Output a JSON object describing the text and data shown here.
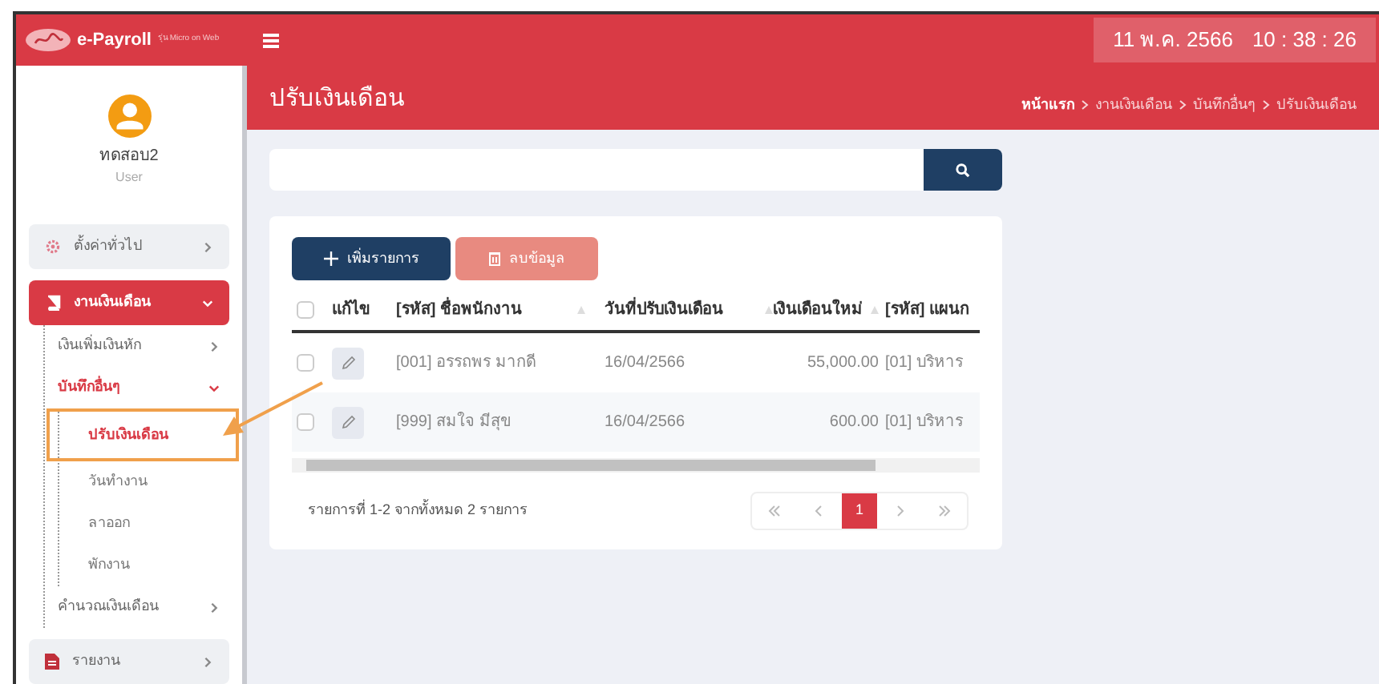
{
  "topbar": {
    "brand": "e-Payroll",
    "brand_sub": "รุ่น Micro on Web",
    "date": "11 พ.ค. 2566",
    "time": "10 : 38 : 26"
  },
  "user": {
    "name": "ทดสอบ2",
    "role": "User"
  },
  "menu": [
    {
      "label": "ตั้งค่าทั่วไป",
      "expanded": false,
      "selected": false
    },
    {
      "label": "งานเงินเดือน",
      "expanded": true,
      "selected": true,
      "children": [
        {
          "label": "เงินเพิ่มเงินหัก",
          "expanded": false,
          "selected": false
        },
        {
          "label": "บันทึกอื่นๆ",
          "expanded": true,
          "selected": true,
          "children": [
            {
              "label": "ปรับเงินเดือน",
              "selected": true
            },
            {
              "label": "วันทำงาน",
              "selected": false
            },
            {
              "label": "ลาออก",
              "selected": false
            },
            {
              "label": "พักงาน",
              "selected": false
            }
          ]
        },
        {
          "label": "คำนวณเงินเดือน",
          "expanded": false,
          "selected": false
        }
      ]
    },
    {
      "label": "รายงาน",
      "expanded": false,
      "selected": false
    }
  ],
  "page": {
    "title": "ปรับเงินเดือน",
    "breadcrumb": [
      "หน้าแรก",
      "งานเงินเดือน",
      "บันทึกอื่นๆ",
      "ปรับเงินเดือน"
    ]
  },
  "actions": [
    {
      "label": "เพิ่มรายการ",
      "kind": "add"
    },
    {
      "label": "ลบข้อมูล",
      "kind": "delete"
    }
  ],
  "table": {
    "all_checked": false,
    "columns": [
      {
        "label": "แก้ไข",
        "sortable": false
      },
      {
        "label": "[รหัส] ชื่อพนักงาน",
        "sortable": true
      },
      {
        "label": "วันที่ปรับเงินเดือน",
        "sortable": true
      },
      {
        "label": "เงินเดือนใหม่",
        "sortable": true
      },
      {
        "label": "[รหัส] แผนก",
        "sortable": false
      }
    ],
    "rows": [
      {
        "checked": false,
        "employee": "[001] อรรถพร มากดี",
        "date": "16/04/2566",
        "salary": "55,000.00",
        "department": "[01] บริหาร"
      },
      {
        "checked": false,
        "employee": "[999] สมใจ มีสุข",
        "date": "16/04/2566",
        "salary": "600.00",
        "department": "[01] บริหาร"
      }
    ]
  },
  "summary": "รายการที่ 1-2 จากทั้งหมด 2 รายการ",
  "pagination": {
    "pages": [
      {
        "label": "1",
        "selected": true
      }
    ]
  }
}
